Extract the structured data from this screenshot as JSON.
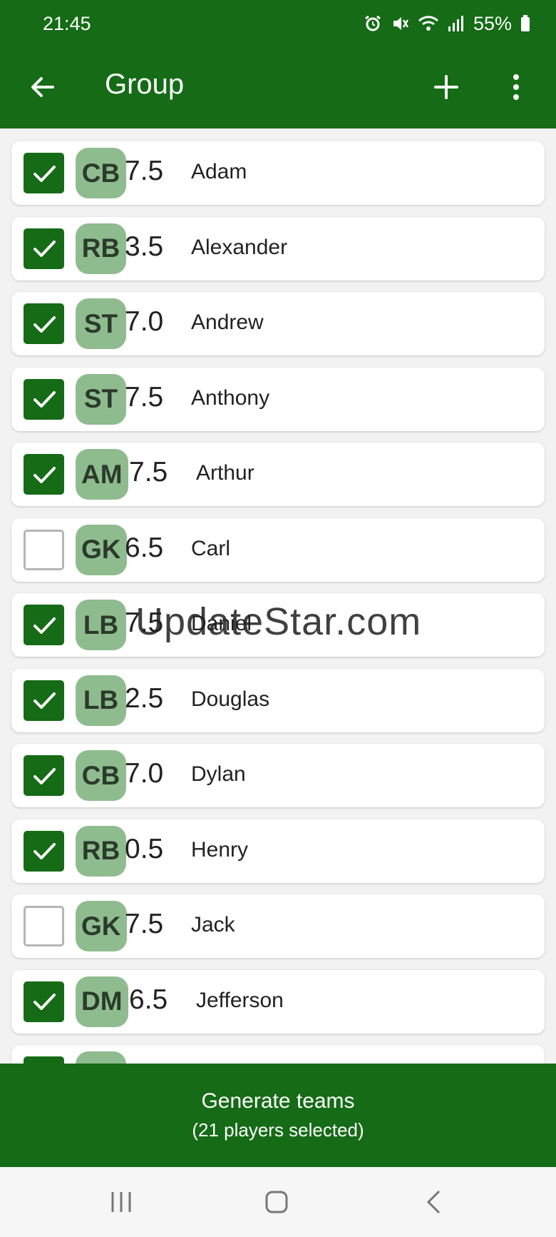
{
  "status_bar": {
    "time": "21:45",
    "battery": "55%",
    "icons": [
      "alarm-icon",
      "mute-icon",
      "wifi-icon",
      "signal-icon",
      "battery-icon"
    ]
  },
  "toolbar": {
    "title": "Group",
    "back_icon": "arrow-left-icon",
    "add_icon": "plus-icon",
    "more_icon": "more-vertical-icon"
  },
  "colors": {
    "primary": "#156b16",
    "badge": "#8fbc8f",
    "card": "#ffffff",
    "background": "#f2f2f2"
  },
  "players": [
    {
      "checked": true,
      "position": "CB",
      "rating": "7.5",
      "name": "Adam"
    },
    {
      "checked": true,
      "position": "RB",
      "rating": "3.5",
      "name": "Alexander"
    },
    {
      "checked": true,
      "position": "ST",
      "rating": "7.0",
      "name": "Andrew"
    },
    {
      "checked": true,
      "position": "ST",
      "rating": "7.5",
      "name": "Anthony"
    },
    {
      "checked": true,
      "position": "AM",
      "rating": "7.5",
      "name": "Arthur"
    },
    {
      "checked": false,
      "position": "GK",
      "rating": "6.5",
      "name": "Carl"
    },
    {
      "checked": true,
      "position": "LB",
      "rating": "7.5",
      "name": "Daniel"
    },
    {
      "checked": true,
      "position": "LB",
      "rating": "2.5",
      "name": "Douglas"
    },
    {
      "checked": true,
      "position": "CB",
      "rating": "7.0",
      "name": "Dylan"
    },
    {
      "checked": true,
      "position": "RB",
      "rating": "0.5",
      "name": "Henry"
    },
    {
      "checked": false,
      "position": "GK",
      "rating": "7.5",
      "name": "Jack"
    },
    {
      "checked": true,
      "position": "DM",
      "rating": "6.5",
      "name": "Jefferson"
    },
    {
      "checked": true,
      "position": "",
      "rating": "",
      "name": ""
    }
  ],
  "watermark": "UpdateStar.com",
  "generate": {
    "label": "Generate teams",
    "sublabel": "(21 players selected)"
  },
  "navbar": {
    "recents_icon": "recents-icon",
    "home_icon": "home-icon",
    "back_icon": "nav-back-icon"
  }
}
